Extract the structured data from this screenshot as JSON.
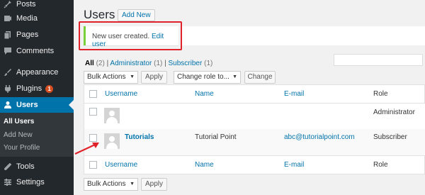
{
  "sidebar": {
    "items": [
      {
        "label": "Posts",
        "icon": "pin-icon"
      },
      {
        "label": "Media",
        "icon": "media-icon"
      },
      {
        "label": "Pages",
        "icon": "pages-icon"
      },
      {
        "label": "Comments",
        "icon": "comments-icon"
      },
      {
        "label": "Appearance",
        "icon": "paintbrush-icon"
      },
      {
        "label": "Plugins",
        "icon": "plugin-icon",
        "badge": "1"
      },
      {
        "label": "Users",
        "icon": "users-icon",
        "current": true
      },
      {
        "label": "Tools",
        "icon": "wrench-icon"
      },
      {
        "label": "Settings",
        "icon": "settings-icon"
      }
    ],
    "submenu": [
      "All Users",
      "Add New",
      "Your Profile"
    ]
  },
  "page": {
    "title": "Users",
    "add_new": "Add New"
  },
  "notice": {
    "text": "New user created.",
    "link": "Edit user"
  },
  "filters": {
    "all": "All",
    "all_count": "(2)",
    "administrator": "Administrator",
    "administrator_count": "(1)",
    "subscriber": "Subscriber",
    "subscriber_count": "(1)",
    "separator": "|"
  },
  "top_actions": {
    "bulk_actions": "Bulk Actions",
    "apply": "Apply",
    "change_role": "Change role to...",
    "change": "Change"
  },
  "table": {
    "columns": [
      "Username",
      "Name",
      "E-mail",
      "Role"
    ],
    "rows": [
      {
        "username": "",
        "name": "",
        "email": "",
        "role": "Administrator"
      },
      {
        "username": "Tutorials",
        "name": "Tutorial Point",
        "email": "abc@tutorialpoint.com",
        "role": "Subscriber"
      }
    ]
  },
  "bottom_actions": {
    "bulk_actions": "Bulk Actions",
    "apply": "Apply"
  },
  "colors": {
    "sidebar_bg": "#23282d",
    "accent": "#0073aa",
    "notice_border": "#7ad03a",
    "highlight": "#e0222a"
  }
}
